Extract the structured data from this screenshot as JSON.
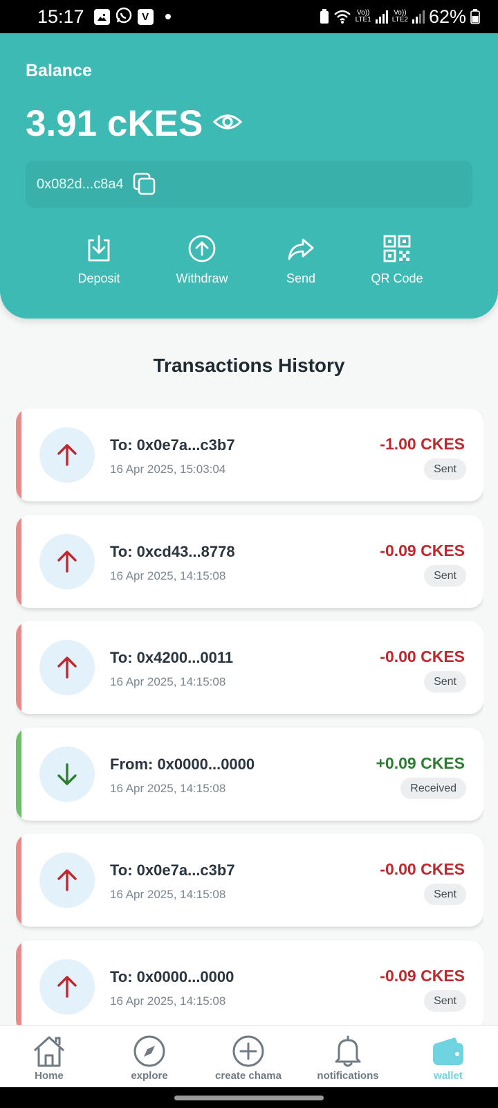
{
  "status_bar": {
    "time": "15:17",
    "lte1": "LTE1",
    "lte2": "LTE2",
    "vo": "Vo))",
    "battery": "62%"
  },
  "wallet": {
    "balance_label": "Balance",
    "balance_amount": "3.91 cKES",
    "address": "0x082d...c8a4",
    "actions": [
      {
        "label": "Deposit",
        "icon": "download-icon"
      },
      {
        "label": "Withdraw",
        "icon": "arrow-up-circle-icon"
      },
      {
        "label": "Send",
        "icon": "share-forward-icon"
      },
      {
        "label": "QR Code",
        "icon": "qr-code-icon"
      }
    ]
  },
  "transactions": {
    "title": "Transactions History",
    "items": [
      {
        "title": "To: 0x0e7a...c3b7",
        "date": "16 Apr 2025, 15:03:04",
        "amount": "-1.00 CKES",
        "status": "Sent",
        "direction": "sent"
      },
      {
        "title": "To: 0xcd43...8778",
        "date": "16 Apr 2025, 14:15:08",
        "amount": "-0.09 CKES",
        "status": "Sent",
        "direction": "sent"
      },
      {
        "title": "To: 0x4200...0011",
        "date": "16 Apr 2025, 14:15:08",
        "amount": "-0.00 CKES",
        "status": "Sent",
        "direction": "sent"
      },
      {
        "title": "From: 0x0000...0000",
        "date": "16 Apr 2025, 14:15:08",
        "amount": "+0.09 CKES",
        "status": "Received",
        "direction": "received"
      },
      {
        "title": "To: 0x0e7a...c3b7",
        "date": "16 Apr 2025, 14:15:08",
        "amount": "-0.00 CKES",
        "status": "Sent",
        "direction": "sent"
      },
      {
        "title": "To: 0x0000...0000",
        "date": "16 Apr 2025, 14:15:08",
        "amount": "-0.09 CKES",
        "status": "Sent",
        "direction": "sent"
      }
    ]
  },
  "nav": {
    "items": [
      {
        "label": "Home",
        "icon": "home-icon"
      },
      {
        "label": "explore",
        "icon": "compass-icon"
      },
      {
        "label": "create chama",
        "icon": "plus-circle-icon"
      },
      {
        "label": "notifications",
        "icon": "bell-icon"
      },
      {
        "label": "wallet",
        "icon": "wallet-icon",
        "active": true
      }
    ]
  },
  "colors": {
    "header": "#3dbab3",
    "sent": "#c0282d",
    "received": "#2e7d32",
    "active_nav": "#6fd3e0"
  }
}
